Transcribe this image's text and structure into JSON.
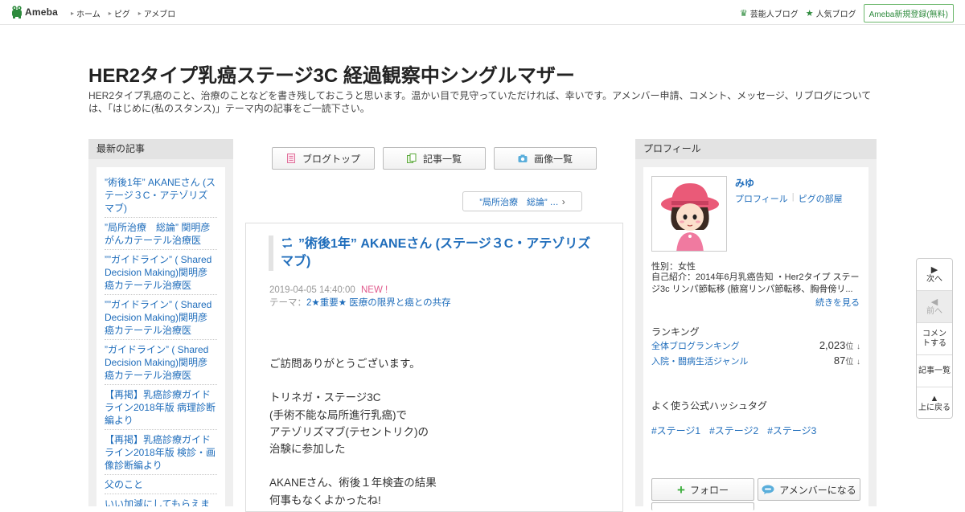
{
  "header": {
    "logo_text": "Ameba",
    "nav": [
      "ホーム",
      "ピグ",
      "アメブロ"
    ],
    "right_links": [
      "芸能人ブログ",
      "人気ブログ"
    ],
    "register_label": "Ameba新規登録(無料)"
  },
  "blog": {
    "title": "HER2タイプ乳癌ステージ3C 経過観察中シングルマザー",
    "description": "HER2タイプ乳癌のこと、治療のことなどを書き残しておこうと思います。温かい目で見守っていただければ、幸いです。アメンバー申請、コメント、メッセージ、リブログについては、「はじめに(私のスタンス)」テーマ内の記事をご一読下さい。"
  },
  "left_sidebar": {
    "heading": "最新の記事",
    "items": [
      "”術後1年” AKANEさん (ステージ３C・アテゾリズマブ)",
      "”局所治療　総論” 関明彦がんカテーテル治療医",
      "””ガイドライン” ( Shared Decision Making)関明彦癌カテーテル治療医",
      "””ガイドライン” ( Shared Decision Making)関明彦癌カテーテル治療医",
      "”ガイドライン” ( Shared Decision Making)関明彦癌カテーテル治療医",
      "【再掲】乳癌診療ガイドライン2018年版 病理診断編より",
      "【再掲】乳癌診療ガイドライン2018年版 検診・画像診断編より",
      "父のこと",
      "いい加減にしてもらえま"
    ]
  },
  "tabs": {
    "blog_top": "ブログトップ",
    "article_list": "記事一覧",
    "image_list": "画像一覧"
  },
  "prev_article": "”局所治療　総論” …",
  "article": {
    "title": "”術後1年” AKANEさん (ステージ３C・アテゾリズマブ)",
    "datetime": "2019-04-05 14:40:00",
    "new_badge": "NEW !",
    "theme_label": "テーマ：",
    "theme": "2★重要★ 医療の限界と癌との共存",
    "body": [
      "ご訪問ありがとうございます。",
      "",
      "トリネガ・ステージ3C",
      "(手術不能な局所進行乳癌)で",
      "アテゾリズマブ(テセントリク)の",
      "治験に参加した",
      "",
      "AKANEさん、術後１年検査の結果",
      "何事もなくよかったね!"
    ]
  },
  "profile": {
    "heading": "プロフィール",
    "name": "みゆ",
    "link_profile": "プロフィール",
    "link_pig": "ピグの部屋",
    "gender": "性別：女性",
    "intro": "自己紹介：2014年6月乳癌告知 ・Her2タイプ ステージ3c リンパ節転移 (腋窩リンパ節転移、胸骨傍リ...",
    "more": "続きを見る",
    "ranking_heading": "ランキング",
    "rankings": [
      {
        "name": "全体ブログランキング",
        "value": "2,023",
        "unit": "位",
        "trend": "↓"
      },
      {
        "name": "入院・闘病生活ジャンル",
        "value": "87",
        "unit": "位",
        "trend": "↓"
      }
    ],
    "hashtag_heading": "よく使う公式ハッシュタグ",
    "hashtags": [
      "#ステージ1",
      "#ステージ2",
      "#ステージ3"
    ],
    "follow_label": "フォロー",
    "amember_label": "アメンバーになる"
  },
  "float_nav": {
    "next": "次へ",
    "prev": "前へ",
    "comment": "コメントする",
    "list": "記事一覧",
    "top": "上に戻る"
  },
  "colors": {
    "link": "#1f6dbb",
    "brand_green": "#2e8b3d",
    "new_badge": "#e05a8c"
  }
}
